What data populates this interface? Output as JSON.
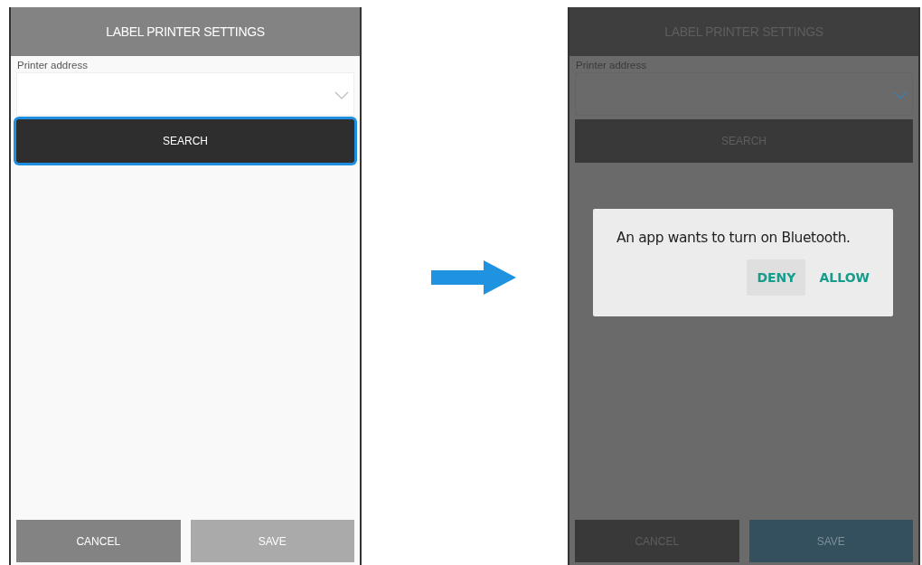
{
  "screens": [
    {
      "dimmed": false,
      "title": "LABEL PRINTER SETTINGS",
      "field_label": "Printer address",
      "search": {
        "label": "SEARCH",
        "focused": true
      },
      "buttons": [
        {
          "label": "CANCEL",
          "kind": "cancel",
          "disabled": false
        },
        {
          "label": "SAVE",
          "kind": "save",
          "disabled": true
        }
      ]
    },
    {
      "dimmed": true,
      "title": "LABEL PRINTER SETTINGS",
      "field_label": "Printer address",
      "search": {
        "label": "SEARCH",
        "focused": false
      },
      "buttons": [
        {
          "label": "CANCEL",
          "kind": "cancel",
          "disabled": false
        },
        {
          "label": "SAVE",
          "kind": "save",
          "disabled": false
        }
      ],
      "dialog": {
        "message": "An app wants to turn on Bluetooth.",
        "actions": [
          {
            "label": "DENY",
            "selected": true
          },
          {
            "label": "ALLOW",
            "selected": false
          }
        ]
      }
    }
  ]
}
